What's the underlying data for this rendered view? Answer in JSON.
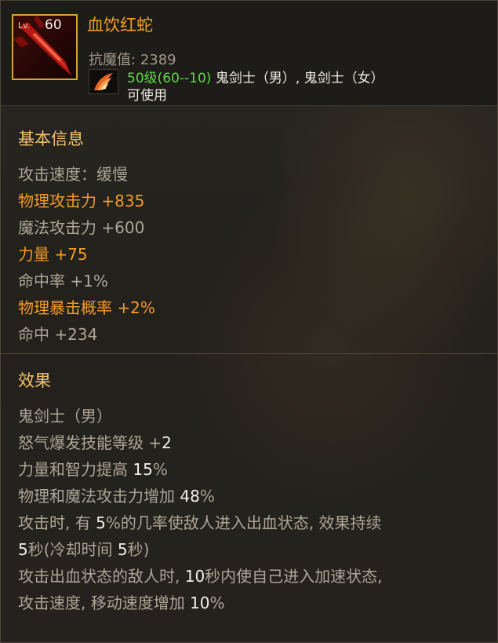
{
  "item": {
    "level_prefix": "Lv.",
    "level": "60",
    "name": "血饮红蛇",
    "anti_magic_label": "抗魔值:",
    "anti_magic_value": "2389",
    "level_requirement": "50级(60--10)",
    "classes": " 鬼剑士（男）, 鬼剑士（女）",
    "usable": "可使用"
  },
  "basic_info": {
    "title": "基本信息",
    "lines": [
      {
        "text": "攻击速度：缓慢",
        "highlight": false
      },
      {
        "text": "物理攻击力 +835",
        "highlight": true
      },
      {
        "text": "魔法攻击力 +600",
        "highlight": false
      },
      {
        "text": "力量 +75",
        "highlight": true
      },
      {
        "text": "命中率 +1%",
        "highlight": false
      },
      {
        "text": "物理暴击概率 +2%",
        "highlight": true
      },
      {
        "text": "命中 +234",
        "highlight": false
      }
    ]
  },
  "effects": {
    "title": "效果",
    "lines": [
      [
        "鬼剑士（男）"
      ],
      [
        "怒气爆发技能等级 +",
        "2"
      ],
      [
        "力量和智力提高 ",
        "15",
        "%"
      ],
      [
        "物理和魔法攻击力增加 ",
        "48",
        "%"
      ],
      [
        "攻击时, 有 ",
        "5",
        "%的几率使敌人进入出血状态, 效果持续"
      ],
      [
        "",
        "5",
        "秒(冷却时间 ",
        "5",
        "秒)"
      ],
      [
        "攻击出血状态的敌人时, ",
        "10",
        "秒内使自己进入加速状态,"
      ],
      [
        "攻击速度, 移动速度增加 ",
        "10",
        "%"
      ]
    ]
  },
  "colors": {
    "name": "#f3a023",
    "highlight": "#f49a26",
    "level_req": "#5fd94a",
    "section_title": "#f1c26a"
  },
  "icons": {
    "item_icon": "red-serpent-sword-icon",
    "class_icon": "flame-wing-icon"
  }
}
